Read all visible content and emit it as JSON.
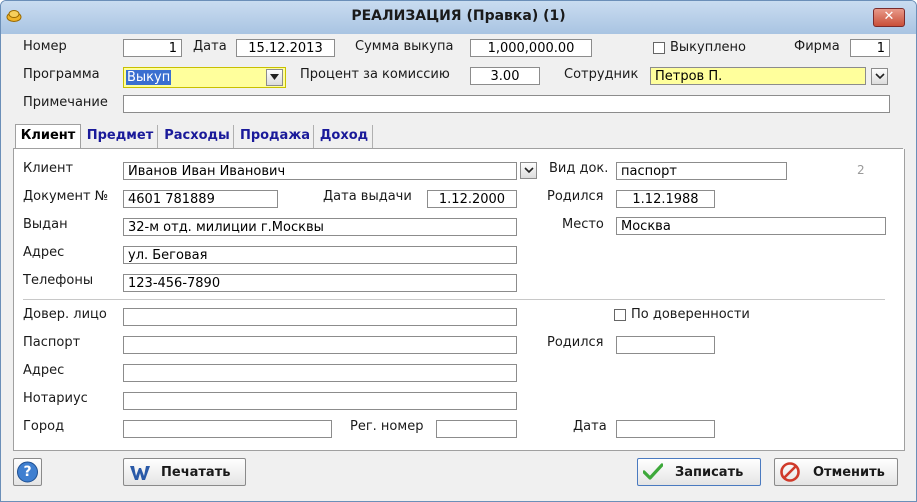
{
  "window": {
    "title": "РЕАЛИЗАЦИЯ (Правка)  (1)",
    "close_label": "✕"
  },
  "header": {
    "nomer_label": "Номер",
    "nomer_value": "1",
    "data_label": "Дата",
    "data_value": "15.12.2013",
    "summa_label": "Сумма выкупа",
    "summa_value": "1,000,000.00",
    "vykupleno_label": "Выкуплено",
    "firma_label": "Фирма",
    "firma_value": "1",
    "programma_label": "Программа",
    "programma_value": "Выкуп",
    "procent_label": "Процент за комиссию",
    "procent_value": "3.00",
    "sotrudnik_label": "Сотрудник",
    "sotrudnik_value": "Петров П.",
    "primechanie_label": "Примечание",
    "primechanie_value": ""
  },
  "tabs": [
    {
      "label": "Клиент"
    },
    {
      "label": "Предмет"
    },
    {
      "label": "Расходы"
    },
    {
      "label": "Продажа"
    },
    {
      "label": "Доход"
    }
  ],
  "client": {
    "klient_label": "Клиент",
    "klient_value": "Иванов Иван Иванович",
    "vid_dok_label": "Вид док.",
    "vid_dok_value": "паспорт",
    "counter": "2",
    "dokument_label": "Документ №",
    "dokument_value": "4601 781889",
    "data_vydachi_label": "Дата выдачи",
    "data_vydachi_value": "1.12.2000",
    "rodilsya_label": "Родился",
    "rodilsya_value": "1.12.1988",
    "vydan_label": "Выдан",
    "vydan_value": "32-м отд. милиции г.Москвы",
    "mesto_label": "Место",
    "mesto_value": "Москва",
    "adres_label": "Адрес",
    "adres_value": "ул. Беговая",
    "telefony_label": "Телефоны",
    "telefony_value": "123-456-7890"
  },
  "proxy": {
    "dover_label": "Довер. лицо",
    "dover_value": "",
    "po_doverennosti_label": "По доверенности",
    "pasport_label": "Паспорт",
    "pasport_value": "",
    "rodilsya_label": "Родился",
    "rodilsya_value": "",
    "adres_label": "Адрес",
    "adres_value": "",
    "notarius_label": "Нотариус",
    "notarius_value": "",
    "gorod_label": "Город",
    "gorod_value": "",
    "reg_nomer_label": "Рег. номер",
    "reg_nomer_value": "",
    "data_label": "Дата",
    "data_value": ""
  },
  "footer": {
    "help_label": "?",
    "print_label": "Печатать",
    "save_label": "Записать",
    "cancel_label": "Отменить"
  },
  "colors": {
    "highlight": "#ffff9c",
    "tab_link": "#1a1a9a",
    "title_bar": "#b8d0ea"
  }
}
